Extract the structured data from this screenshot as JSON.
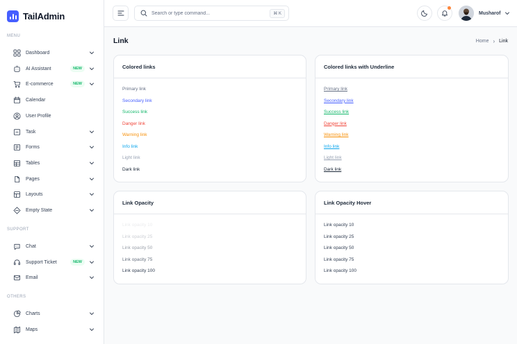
{
  "brand": {
    "name": "TailAdmin"
  },
  "sidebar": {
    "sections": {
      "menu": "MENU",
      "support": "SUPPORT",
      "others": "OTHERS"
    },
    "items": [
      {
        "label": "Dashboard",
        "icon": "grid-icon",
        "badge": "",
        "chevron": true
      },
      {
        "label": "AI Assistant",
        "icon": "ai-icon",
        "badge": "NEW",
        "chevron": true
      },
      {
        "label": "E-commerce",
        "icon": "cart-icon",
        "badge": "NEW",
        "chevron": true
      },
      {
        "label": "Calendar",
        "icon": "calendar-icon",
        "badge": "",
        "chevron": false
      },
      {
        "label": "User Profile",
        "icon": "user-icon",
        "badge": "",
        "chevron": false
      },
      {
        "label": "Task",
        "icon": "task-icon",
        "badge": "",
        "chevron": true
      },
      {
        "label": "Forms",
        "icon": "form-icon",
        "badge": "",
        "chevron": true
      },
      {
        "label": "Tables",
        "icon": "table-icon",
        "badge": "",
        "chevron": true
      },
      {
        "label": "Pages",
        "icon": "pages-icon",
        "badge": "",
        "chevron": true
      },
      {
        "label": "Layouts",
        "icon": "layout-icon",
        "badge": "",
        "chevron": true
      },
      {
        "label": "Empty State",
        "icon": "box-icon",
        "badge": "",
        "chevron": true
      },
      {
        "label": "Chat",
        "icon": "chat-icon",
        "badge": "",
        "chevron": true
      },
      {
        "label": "Support Ticket",
        "icon": "headset-icon",
        "badge": "NEW",
        "chevron": true
      },
      {
        "label": "Email",
        "icon": "mail-icon",
        "badge": "",
        "chevron": true
      },
      {
        "label": "Charts",
        "icon": "pie-chart-icon",
        "badge": "",
        "chevron": true
      },
      {
        "label": "Maps",
        "icon": "map-icon",
        "badge": "",
        "chevron": true
      }
    ]
  },
  "header": {
    "search_placeholder": "Search or type command...",
    "shortcut": "⌘ K",
    "user_name": "Musharof"
  },
  "page": {
    "title": "Link",
    "breadcrumb": {
      "home": "Home",
      "current": "Link"
    }
  },
  "cards": {
    "colored": {
      "title": "Colored links",
      "links": [
        {
          "label": "Primary link",
          "color": "#667085"
        },
        {
          "label": "Secondary link",
          "color": "#465fff"
        },
        {
          "label": "Success link",
          "color": "#12b76a"
        },
        {
          "label": "Danger link",
          "color": "#f04438"
        },
        {
          "label": "Warning link",
          "color": "#f79009"
        },
        {
          "label": "Info link",
          "color": "#0ba5ec"
        },
        {
          "label": "Light link",
          "color": "#98a2b3"
        },
        {
          "label": "Dark link",
          "color": "#1d2939"
        }
      ]
    },
    "underline": {
      "title": "Colored links with Underline",
      "links": [
        {
          "label": "Primary link",
          "color": "#667085"
        },
        {
          "label": "Secondary link",
          "color": "#465fff"
        },
        {
          "label": "Success link",
          "color": "#12b76a"
        },
        {
          "label": "Danger link",
          "color": "#f04438"
        },
        {
          "label": "Warning link",
          "color": "#f79009"
        },
        {
          "label": "Info link",
          "color": "#0ba5ec"
        },
        {
          "label": "Light link",
          "color": "#98a2b3"
        },
        {
          "label": "Dark link",
          "color": "#1d2939"
        }
      ]
    },
    "opacity": {
      "title": "Link Opacity",
      "links": [
        {
          "label": "Link opacity 10",
          "opacity": 0.1
        },
        {
          "label": "Link opacity 25",
          "opacity": 0.25
        },
        {
          "label": "Link opacity 50",
          "opacity": 0.5
        },
        {
          "label": "Link opacity 75",
          "opacity": 0.75
        },
        {
          "label": "Link opacity 100",
          "opacity": 1
        }
      ]
    },
    "opacity_hover": {
      "title": "Link Opacity Hover",
      "links": [
        {
          "label": "Link opacity 10"
        },
        {
          "label": "Link opacity 25"
        },
        {
          "label": "Link opacity 50"
        },
        {
          "label": "Link opacity 75"
        },
        {
          "label": "Link opacity 100"
        }
      ]
    }
  },
  "colors": {
    "accent": "#465fff",
    "notification_dot": "#fd853a",
    "new_badge": "#12b76a"
  }
}
